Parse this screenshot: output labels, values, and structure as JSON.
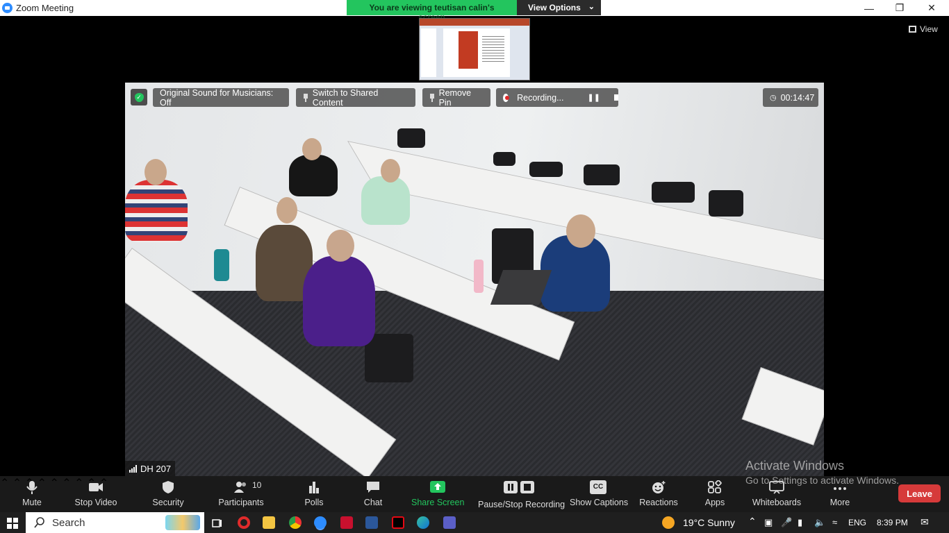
{
  "window": {
    "title": "Zoom Meeting"
  },
  "banner": {
    "viewing_text": "You are viewing teutisan calin's screen",
    "view_options_label": "View Options"
  },
  "view_button": {
    "label": "View"
  },
  "video_controls": {
    "original_sound": "Original Sound for Musicians: Off",
    "switch_shared": "Switch to Shared Content",
    "remove_pin": "Remove Pin",
    "recording": "Recording...",
    "timer": "00:14:47"
  },
  "participant": {
    "name": "DH 207"
  },
  "watermark": {
    "line1": "Activate Windows",
    "line2": "Go to Settings to activate Windows."
  },
  "toolbar": {
    "mute": "Mute",
    "stop_video": "Stop Video",
    "security": "Security",
    "participants": "Participants",
    "participants_count": "10",
    "polls": "Polls",
    "chat": "Chat",
    "share_screen": "Share Screen",
    "pause_stop": "Pause/Stop Recording",
    "captions": "Show Captions",
    "captions_icon_text": "CC",
    "reactions": "Reactions",
    "apps": "Apps",
    "whiteboards": "Whiteboards",
    "more": "More",
    "leave": "Leave",
    "accent_color": "#23c55e",
    "leave_color": "#d63a3a"
  },
  "taskbar": {
    "search_placeholder": "Search",
    "weather": "19°C  Sunny",
    "language": "ENG",
    "time": "8:39 PM"
  }
}
